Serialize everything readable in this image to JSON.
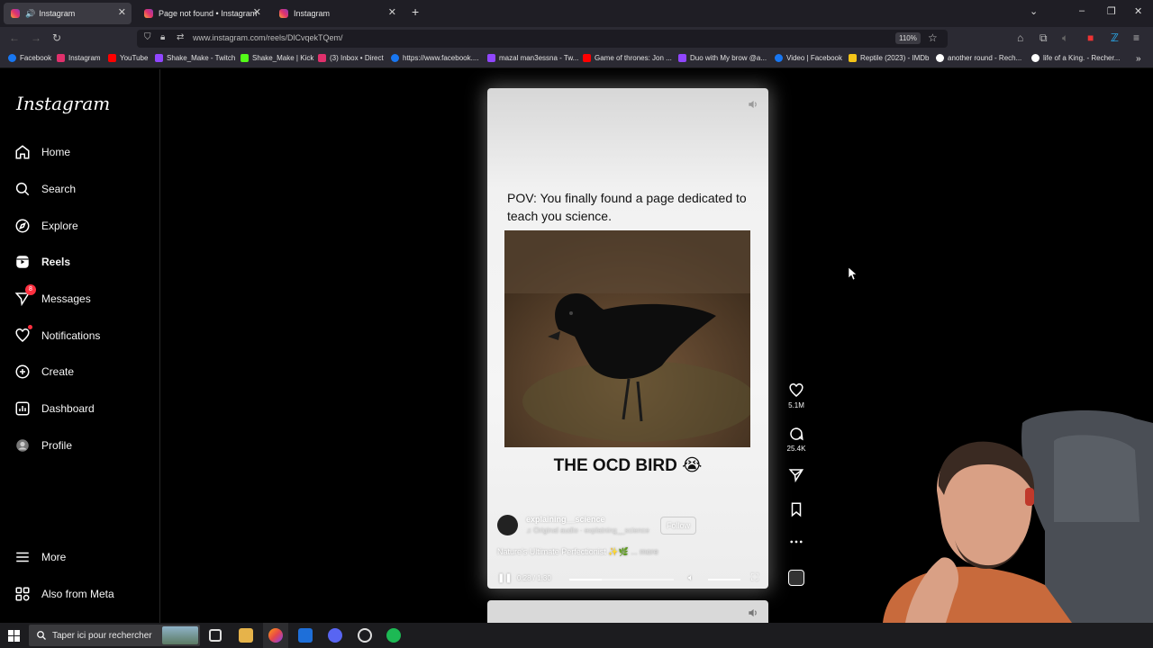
{
  "browser": {
    "tabs": [
      {
        "label": "Instagram",
        "active": true
      },
      {
        "label": "Page not found • Instagram",
        "active": false
      },
      {
        "label": "Instagram",
        "active": false
      }
    ],
    "new_tab_icon": "plus-icon",
    "url": "www.instagram.com/reels/DlCvqekTQem/",
    "zoom": "110%",
    "bookmarks": [
      {
        "label": "Facebook",
        "color": "#1877f2"
      },
      {
        "label": "Instagram",
        "color": "#e1306c"
      },
      {
        "label": "YouTube",
        "color": "#ff0000"
      },
      {
        "label": "Shake_Make - Twitch",
        "color": "#9146ff"
      },
      {
        "label": "Shake_Make | Kick",
        "color": "#53fc18"
      },
      {
        "label": "(3) Inbox • Direct",
        "color": "#e1306c"
      },
      {
        "label": "https://www.facebook....",
        "color": "#1877f2"
      },
      {
        "label": "mazal man3essna - Tw...",
        "color": "#9146ff"
      },
      {
        "label": "Game of thrones: Jon ...",
        "color": "#ff0000"
      },
      {
        "label": "Duo with My brow @a...",
        "color": "#9146ff"
      },
      {
        "label": "Video | Facebook",
        "color": "#1877f2"
      },
      {
        "label": "Reptile (2023) - IMDb",
        "color": "#f5c518"
      },
      {
        "label": "another round - Rech...",
        "color": "#ffffff"
      },
      {
        "label": "life of a King. - Recher...",
        "color": "#ffffff"
      }
    ]
  },
  "sidebar": {
    "logo": "Instagram",
    "items": [
      {
        "label": "Home",
        "icon": "home-icon"
      },
      {
        "label": "Search",
        "icon": "search-icon"
      },
      {
        "label": "Explore",
        "icon": "compass-icon"
      },
      {
        "label": "Reels",
        "icon": "reels-icon"
      },
      {
        "label": "Messages",
        "icon": "messenger-icon",
        "badge": "8"
      },
      {
        "label": "Notifications",
        "icon": "heart-icon"
      },
      {
        "label": "Create",
        "icon": "plus-square-icon"
      },
      {
        "label": "Dashboard",
        "icon": "dashboard-icon"
      },
      {
        "label": "Profile",
        "icon": "profile-avatar"
      }
    ],
    "more": "More",
    "meta": "Also from Meta"
  },
  "reel": {
    "caption_top": "POV: You finally found a page dedicated to teach you science.",
    "title": "THE OCD BIRD 😭",
    "author": "explaining__science",
    "audio": "♫ Original audio · explaining__science",
    "follow": "Follow",
    "description": "Nature's Ultimate Perfectionist ✨🌿",
    "more": "... more",
    "time": "0:28 / 1:30",
    "progress": 0.31,
    "likes": "5.1M",
    "comments": "25.4K"
  },
  "taskbar": {
    "search_placeholder": "Taper ici pour rechercher"
  }
}
